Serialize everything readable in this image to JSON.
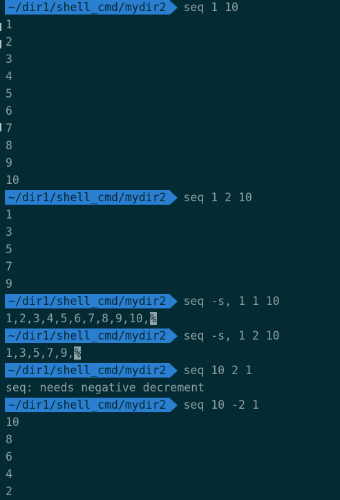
{
  "prompt": {
    "path": "~/dir1/shell_cmd/mydir2"
  },
  "colors": {
    "background": "#042a33",
    "prompt_bg": "#2a7fd1",
    "text": "#8ea1a3"
  },
  "lines": [
    {
      "kind": "prompt",
      "cmd": "seq 1 10"
    },
    {
      "kind": "out",
      "text": "1"
    },
    {
      "kind": "out",
      "text": "2"
    },
    {
      "kind": "out",
      "text": "3"
    },
    {
      "kind": "out",
      "text": "4"
    },
    {
      "kind": "out",
      "text": "5"
    },
    {
      "kind": "out",
      "text": "6"
    },
    {
      "kind": "out",
      "text": "7"
    },
    {
      "kind": "out",
      "text": "8"
    },
    {
      "kind": "out",
      "text": "9"
    },
    {
      "kind": "out",
      "text": "10"
    },
    {
      "kind": "prompt",
      "cmd": "seq 1 2 10"
    },
    {
      "kind": "out",
      "text": "1"
    },
    {
      "kind": "out",
      "text": "3"
    },
    {
      "kind": "out",
      "text": "5"
    },
    {
      "kind": "out",
      "text": "7"
    },
    {
      "kind": "out",
      "text": "9"
    },
    {
      "kind": "prompt",
      "cmd": "seq -s, 1 1 10"
    },
    {
      "kind": "out",
      "text": "1,2,3,4,5,6,7,8,9,10,",
      "mark": "%"
    },
    {
      "kind": "prompt",
      "cmd": "seq -s, 1 2 10"
    },
    {
      "kind": "out",
      "text": "1,3,5,7,9,",
      "mark": "%"
    },
    {
      "kind": "prompt",
      "cmd": "seq 10 2 1"
    },
    {
      "kind": "out",
      "text": "seq: needs negative decrement"
    },
    {
      "kind": "prompt",
      "cmd": "seq 10 -2 1"
    },
    {
      "kind": "out",
      "text": "10"
    },
    {
      "kind": "out",
      "text": "8"
    },
    {
      "kind": "out",
      "text": "6"
    },
    {
      "kind": "out",
      "text": "4"
    },
    {
      "kind": "out",
      "text": "2"
    }
  ]
}
